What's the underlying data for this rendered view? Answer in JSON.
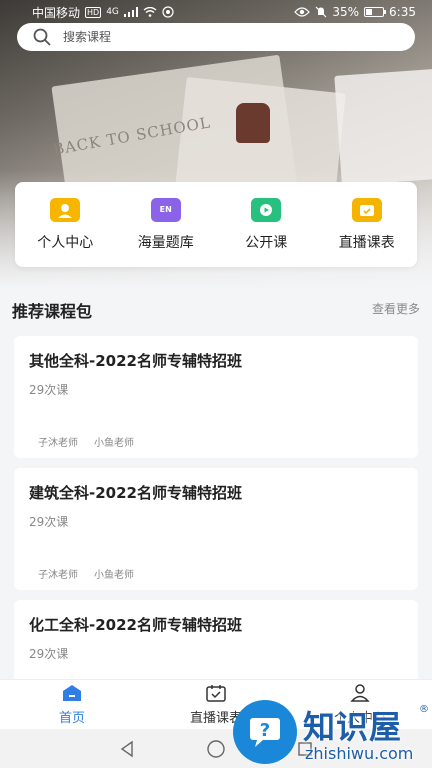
{
  "status_bar": {
    "carrier": "中国移动",
    "hd": "HD",
    "network": "4G",
    "battery": "35%",
    "time": "6:35"
  },
  "search": {
    "placeholder": "搜索课程"
  },
  "quick_menu": [
    {
      "label": "个人中心",
      "icon": "person-icon",
      "color": "#f7b500"
    },
    {
      "label": "海量题库",
      "icon": "book-en-icon",
      "color": "#8b63e8"
    },
    {
      "label": "公开课",
      "icon": "video-play-icon",
      "color": "#27c07e"
    },
    {
      "label": "直播课表",
      "icon": "calendar-check-icon",
      "color": "#f5b400"
    }
  ],
  "section": {
    "title": "推荐课程包",
    "more": "查看更多"
  },
  "courses": [
    {
      "title": "其他全科-2022名师专辅特招班",
      "count": "29次课",
      "teachers": [
        "子沐老师",
        "小鱼老师"
      ]
    },
    {
      "title": "建筑全科-2022名师专辅特招班",
      "count": "29次课",
      "teachers": [
        "子沐老师",
        "小鱼老师"
      ]
    },
    {
      "title": "化工全科-2022名师专辅特招班",
      "count": "29次课",
      "teachers": []
    }
  ],
  "tabbar": [
    {
      "label": "首页",
      "icon": "home-icon",
      "active": true
    },
    {
      "label": "直播课表",
      "icon": "calendar-icon",
      "active": false
    },
    {
      "label": "个人中心",
      "icon": "user-icon",
      "active": false
    }
  ],
  "banner": {
    "text": "BACK TO SCHOOL"
  },
  "watermark": {
    "brand": "知识屋",
    "reg": "®",
    "url": "zhishiwu.com"
  },
  "colors": {
    "accent": "#2e7ee6",
    "watermark": "#1d5ea8"
  }
}
